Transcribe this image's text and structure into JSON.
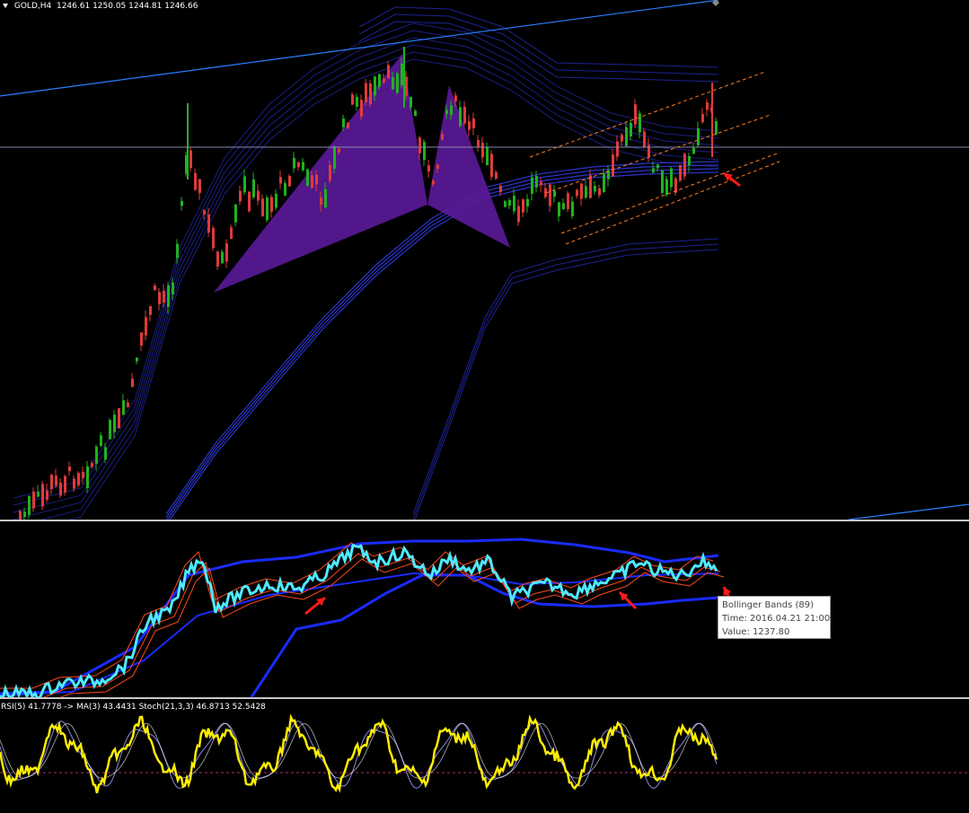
{
  "main_chart": {
    "symbol_label": "GOLD,H4",
    "ohlc": [
      "1246.61",
      "1250.05",
      "1244.81",
      "1246.66"
    ],
    "colors": {
      "background": "#000000",
      "bull_candle": "#1fb21f",
      "bear_candle": "#e03a3a",
      "pattern_fill": "#5b1a99",
      "envelope_band": "#1e2290",
      "trendline": "#2a7fff",
      "channel": "#ff7a1e",
      "price_line": "#8a8ab0"
    }
  },
  "oscillator": {
    "colors": {
      "main_line": "#4fe9ff",
      "bands": "#1a2bff",
      "signal_lines": "#ff4a1a"
    }
  },
  "lower_indicator": {
    "label": "RSI(5) 41.7778 -> MA(3) 43.4431 Stoch(21,3,3) 46.8713 52.5428",
    "colors": {
      "rsi_line": "#ffee00",
      "stoch_lines": "#8a8ae0",
      "level_line": "#b03060"
    }
  },
  "tooltip": {
    "title": "Bollinger Bands (89)",
    "time": "Time: 2016.04.21 21:00",
    "value": "Value: 1237.80"
  },
  "annotations": {
    "arrow_color": "#ff1a1a"
  }
}
